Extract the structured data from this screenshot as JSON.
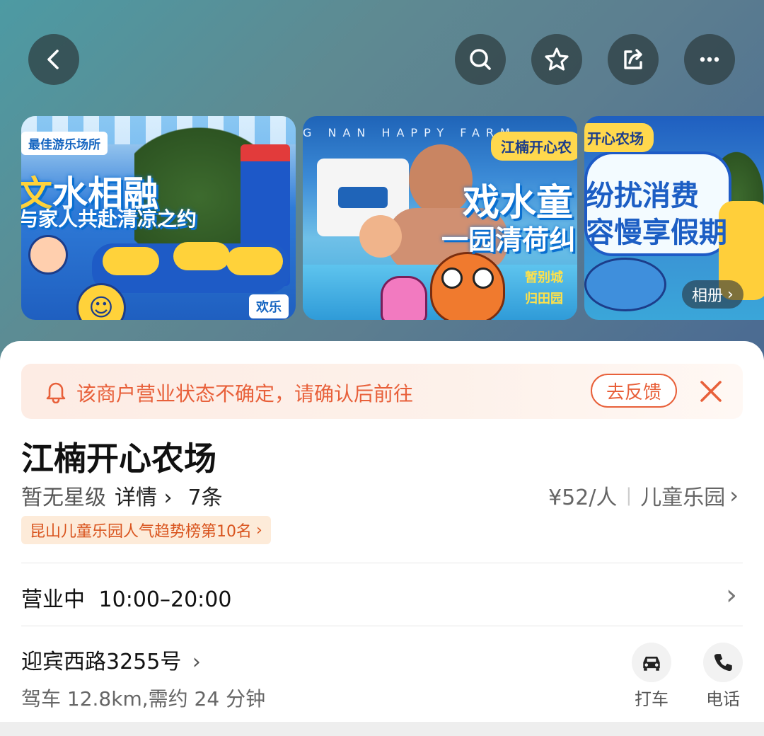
{
  "header": {
    "back_icon": "chevron-left-icon",
    "search_icon": "search-icon",
    "favorite_icon": "star-icon",
    "share_icon": "share-icon",
    "more_icon": "more-dots-icon"
  },
  "gallery": {
    "photo1": {
      "pill": "最佳游乐场所",
      "title_main": "水相融",
      "title_accent": "文",
      "subtitle": "与家人共赴清凉之约",
      "sticker": "欢乐"
    },
    "photo2": {
      "brand": "G NAN HAPPY FARM",
      "pill": "江楠开心农",
      "title1": "戏水童",
      "title2": "一园清荷纠",
      "side1": "暂别城",
      "side2": "归田园"
    },
    "photo3": {
      "pill": "开心农场",
      "title1": "纷扰消费",
      "title2": "容慢享假期",
      "album_label": "相册"
    }
  },
  "notice": {
    "icon": "bell-icon",
    "text": "该商户营业状态不确定，请确认后前往",
    "feedback_label": "去反馈",
    "close_icon": "close-icon",
    "color": "#e8603a"
  },
  "poi": {
    "name": "江楠开心农场",
    "rating_text": "暂无星级",
    "details_label": "详情",
    "review_count": "7条",
    "price": "¥52/人",
    "category": "儿童乐园",
    "rank_text": "昆山儿童乐园人气趋势榜第10名"
  },
  "hours": {
    "status": "营业中",
    "time": "10:00–20:00"
  },
  "address": {
    "text": "迎宾西路3255号",
    "drive_info": "驾车 12.8km,需约 24 分钟",
    "taxi_label": "打车",
    "phone_label": "电话",
    "taxi_icon": "car-icon",
    "phone_icon": "phone-icon"
  }
}
